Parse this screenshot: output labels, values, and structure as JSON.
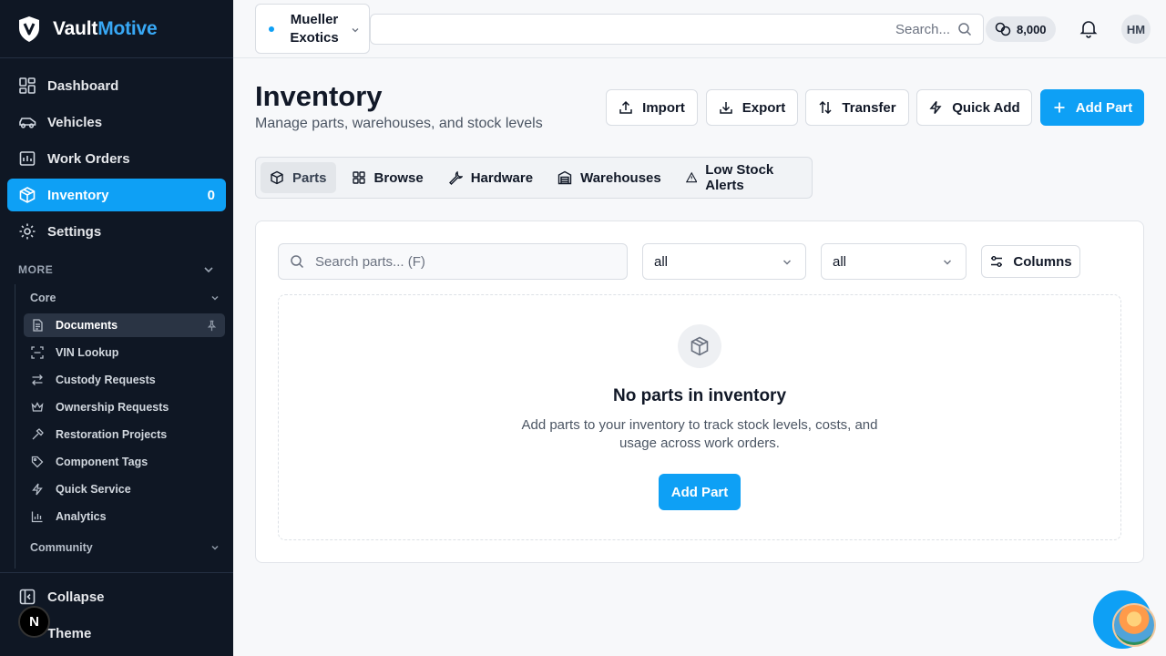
{
  "brand": {
    "name_main": "Vault",
    "name_accent": "Motive"
  },
  "sidebar": {
    "items": [
      {
        "label": "Dashboard",
        "icon": "dashboard-icon"
      },
      {
        "label": "Vehicles",
        "icon": "car-icon"
      },
      {
        "label": "Work Orders",
        "icon": "clipboard-icon"
      },
      {
        "label": "Inventory",
        "icon": "box-icon",
        "count": "0",
        "active": true
      },
      {
        "label": "Settings",
        "icon": "gear-icon"
      }
    ],
    "more_label": "MORE",
    "core_label": "Core",
    "core_items": [
      {
        "label": "Documents",
        "icon": "file-text-icon",
        "active": true
      },
      {
        "label": "VIN Lookup",
        "icon": "scan-icon"
      },
      {
        "label": "Custody Requests",
        "icon": "arrows-left-right-icon"
      },
      {
        "label": "Ownership Requests",
        "icon": "crown-icon"
      },
      {
        "label": "Restoration Projects",
        "icon": "hammer-icon"
      },
      {
        "label": "Component Tags",
        "icon": "tag-icon"
      },
      {
        "label": "Quick Service",
        "icon": "zap-icon"
      },
      {
        "label": "Analytics",
        "icon": "bar-chart-icon"
      }
    ],
    "community_label": "Community",
    "collapse_label": "Collapse",
    "theme_label": "Theme",
    "n_badge": "N"
  },
  "topbar": {
    "org_line1": "Mueller",
    "org_line2": "Exotics",
    "search_placeholder": "Search...",
    "credits": "8,000",
    "avatar_initials": "HM"
  },
  "page": {
    "title": "Inventory",
    "subtitle": "Manage parts, warehouses, and stock levels",
    "actions": {
      "import": "Import",
      "export": "Export",
      "transfer": "Transfer",
      "quick_add": "Quick Add",
      "add_part": "Add Part"
    },
    "tabs": [
      {
        "label": "Parts",
        "icon": "box-icon",
        "active": true
      },
      {
        "label": "Browse",
        "icon": "grid-icon"
      },
      {
        "label": "Hardware",
        "icon": "wrench-icon"
      },
      {
        "label": "Warehouses",
        "icon": "warehouse-icon"
      },
      {
        "label": "Low Stock Alerts",
        "icon": "alert-triangle-icon"
      }
    ]
  },
  "parts": {
    "search_placeholder": "Search parts... (F)",
    "filter1": "all",
    "filter2": "all",
    "columns_label": "Columns",
    "empty_title": "No parts in inventory",
    "empty_desc": "Add parts to your inventory to track stock levels, costs, and usage across work orders.",
    "empty_button": "Add Part"
  },
  "colors": {
    "accent": "#0ea0f5",
    "sidebar_bg": "#0f1724"
  }
}
